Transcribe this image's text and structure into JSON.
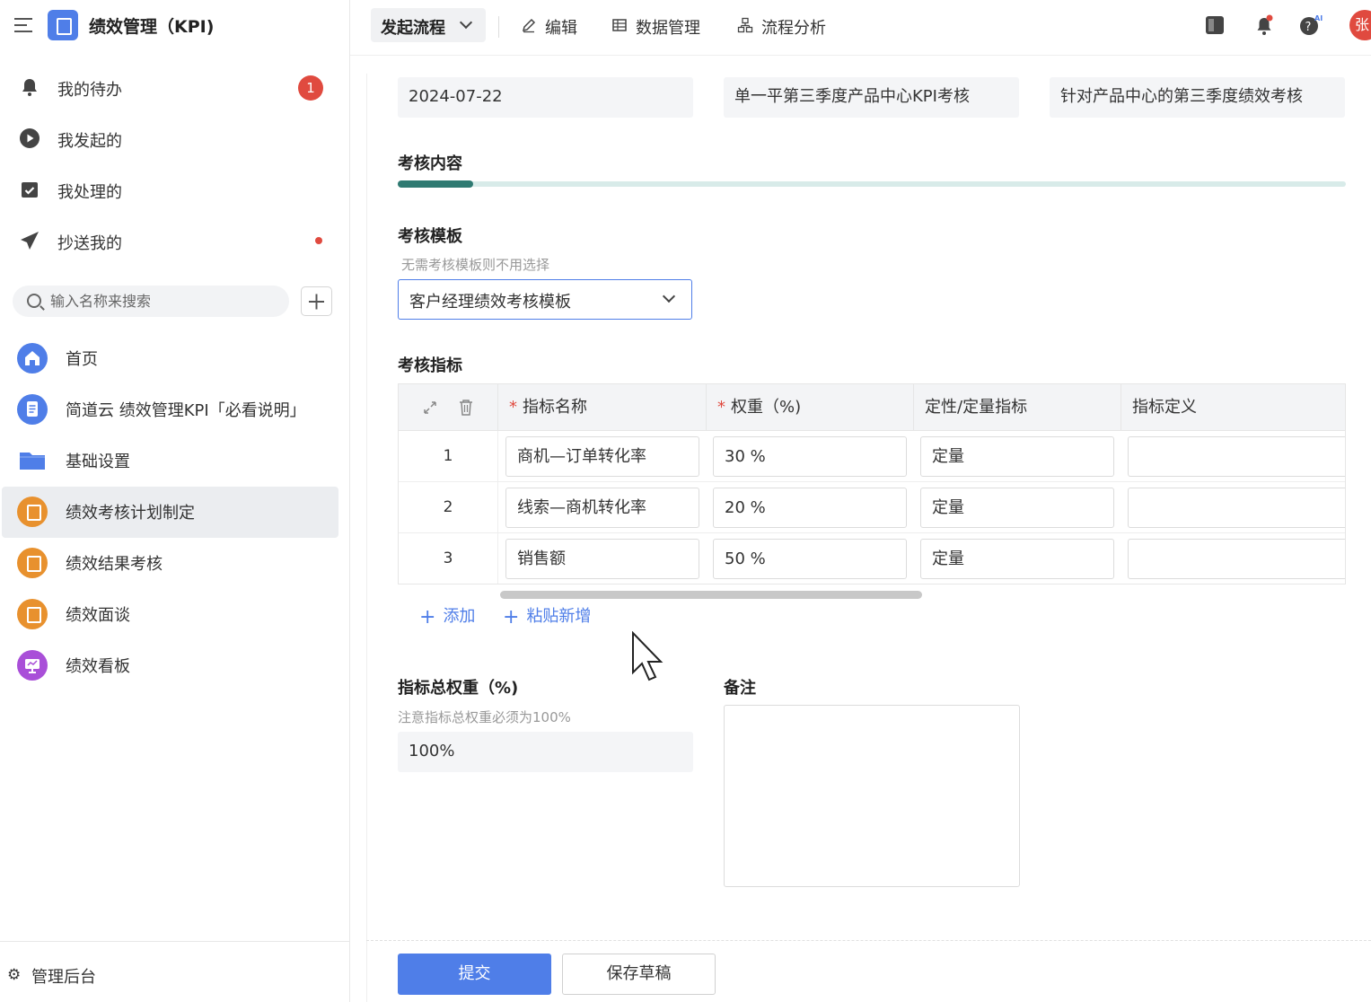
{
  "app": {
    "title": "绩效管理（KPI)"
  },
  "sidebar": {
    "todo": [
      {
        "label": "我的待办",
        "badge": "1"
      },
      {
        "label": "我发起的"
      },
      {
        "label": "我处理的"
      },
      {
        "label": "抄送我的",
        "dot": true
      }
    ],
    "search": {
      "placeholder": "输入名称来搜索"
    },
    "nav": [
      {
        "label": "首页",
        "icon": "home-icon"
      },
      {
        "label": "简道云 绩效管理KPI「必看说明」",
        "icon": "document-icon"
      },
      {
        "label": "基础设置",
        "icon": "folder-icon"
      },
      {
        "label": "绩效考核计划制定",
        "icon": "app-icon",
        "active": true
      },
      {
        "label": "绩效结果考核",
        "icon": "app-icon"
      },
      {
        "label": "绩效面谈",
        "icon": "app-icon"
      },
      {
        "label": "绩效看板",
        "icon": "dashboard-icon"
      }
    ],
    "admin": {
      "label": "管理后台"
    }
  },
  "toolbar": {
    "start_flow": "发起流程",
    "edit": "编辑",
    "data_manage": "数据管理",
    "flow_analysis": "流程分析",
    "avatar": "张"
  },
  "form": {
    "date": "2024-07-22",
    "plan_title": "单一平第三季度产品中心KPI考核",
    "plan_desc": "针对产品中心的第三季度绩效考核",
    "section_content": "考核内容",
    "progress": 0.08,
    "template": {
      "label": "考核模板",
      "hint": "无需考核模板则不用选择",
      "value": "客户经理绩效考核模板"
    },
    "indicators": {
      "label": "考核指标",
      "columns": [
        "指标名称",
        "权重（%)",
        "定性/定量指标",
        "指标定义"
      ],
      "rows": [
        {
          "idx": "1",
          "name": "商机—订单转化率",
          "weight": "30 %",
          "type": "定量",
          "definition": ""
        },
        {
          "idx": "2",
          "name": "线索—商机转化率",
          "weight": "20 %",
          "type": "定量",
          "definition": ""
        },
        {
          "idx": "3",
          "name": "销售额",
          "weight": "50 %",
          "type": "定量",
          "definition": ""
        }
      ],
      "add": "添加",
      "paste_add": "粘贴新增"
    },
    "total_weight": {
      "label": "指标总权重（%)",
      "hint": "注意指标总权重必须为100%",
      "value": "100%"
    },
    "remark": {
      "label": "备注",
      "value": ""
    },
    "submit": "提交",
    "save_draft": "保存草稿"
  },
  "colors": {
    "accent": "#4f7ee8",
    "badge": "#e04a3f",
    "progress": "#2f7a72"
  }
}
